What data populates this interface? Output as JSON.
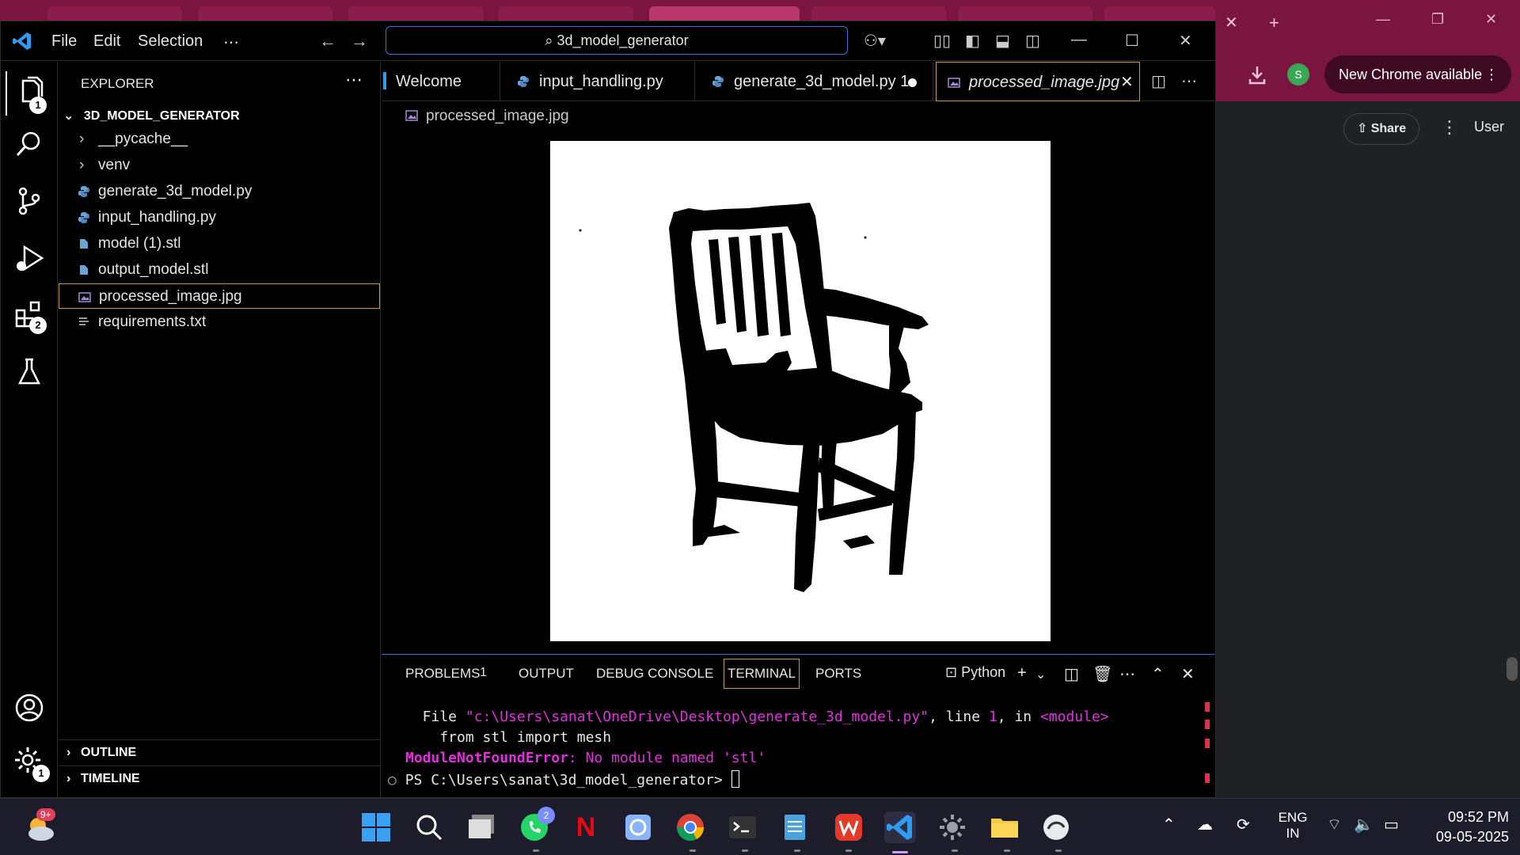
{
  "chrome": {
    "new_chrome_label": "New Chrome available",
    "avatar_letter": "S",
    "share_label": "Share",
    "user_label": "User"
  },
  "vscode": {
    "menu": [
      "File",
      "Edit",
      "Selection",
      "⋯"
    ],
    "command_center": "3d_model_generator",
    "activity_badges": {
      "explorer": "1",
      "extensions": "2",
      "settings": "1"
    },
    "explorer": {
      "title": "EXPLORER",
      "more": "⋯",
      "root": "3D_MODEL_GENERATOR",
      "items": [
        {
          "label": "__pycache__",
          "type": "folder"
        },
        {
          "label": "venv",
          "type": "folder"
        },
        {
          "label": "generate_3d_model.py",
          "type": "python"
        },
        {
          "label": "input_handling.py",
          "type": "python"
        },
        {
          "label": "model (1).stl",
          "type": "stl"
        },
        {
          "label": "output_model.stl",
          "type": "stl"
        },
        {
          "label": "processed_image.jpg",
          "type": "image"
        },
        {
          "label": "requirements.txt",
          "type": "text"
        }
      ],
      "outline": "OUTLINE",
      "timeline": "TIMELINE"
    },
    "tabs": [
      {
        "label": "Welcome"
      },
      {
        "label": "input_handling.py"
      },
      {
        "label": "generate_3d_model.py 1"
      },
      {
        "label": "processed_image.jpg"
      }
    ],
    "breadcrumb": "processed_image.jpg",
    "panel": {
      "tabs": [
        "PROBLEMS",
        "OUTPUT",
        "DEBUG CONSOLE",
        "TERMINAL",
        "PORTS"
      ],
      "problems_count": "1",
      "shell": "Python",
      "line1_prefix": "  File ",
      "line1_path": "\"c:\\Users\\sanat\\OneDrive\\Desktop\\generate_3d_model.py\"",
      "line1_mid": ", line ",
      "line1_num": "1",
      "line1_in": ", in ",
      "line1_module": "<module>",
      "line2": "    from stl import mesh",
      "line3_err": "ModuleNotFoundError",
      "line3_rest": ": No module named 'stl'",
      "prompt": "PS C:\\Users\\sanat\\3d_model_generator> "
    }
  },
  "taskbar": {
    "weather_badge": "9+",
    "whatsapp_badge": "2",
    "lang_top": "ENG",
    "lang_bottom": "IN",
    "time": "09:52 PM",
    "date": "09-05-2025"
  },
  "colors": {
    "accent_border": "#c79a3a",
    "focus_blue": "#3c6ee0",
    "terminal_magenta": "#e32fe0",
    "chrome_frame": "#7a1540"
  }
}
